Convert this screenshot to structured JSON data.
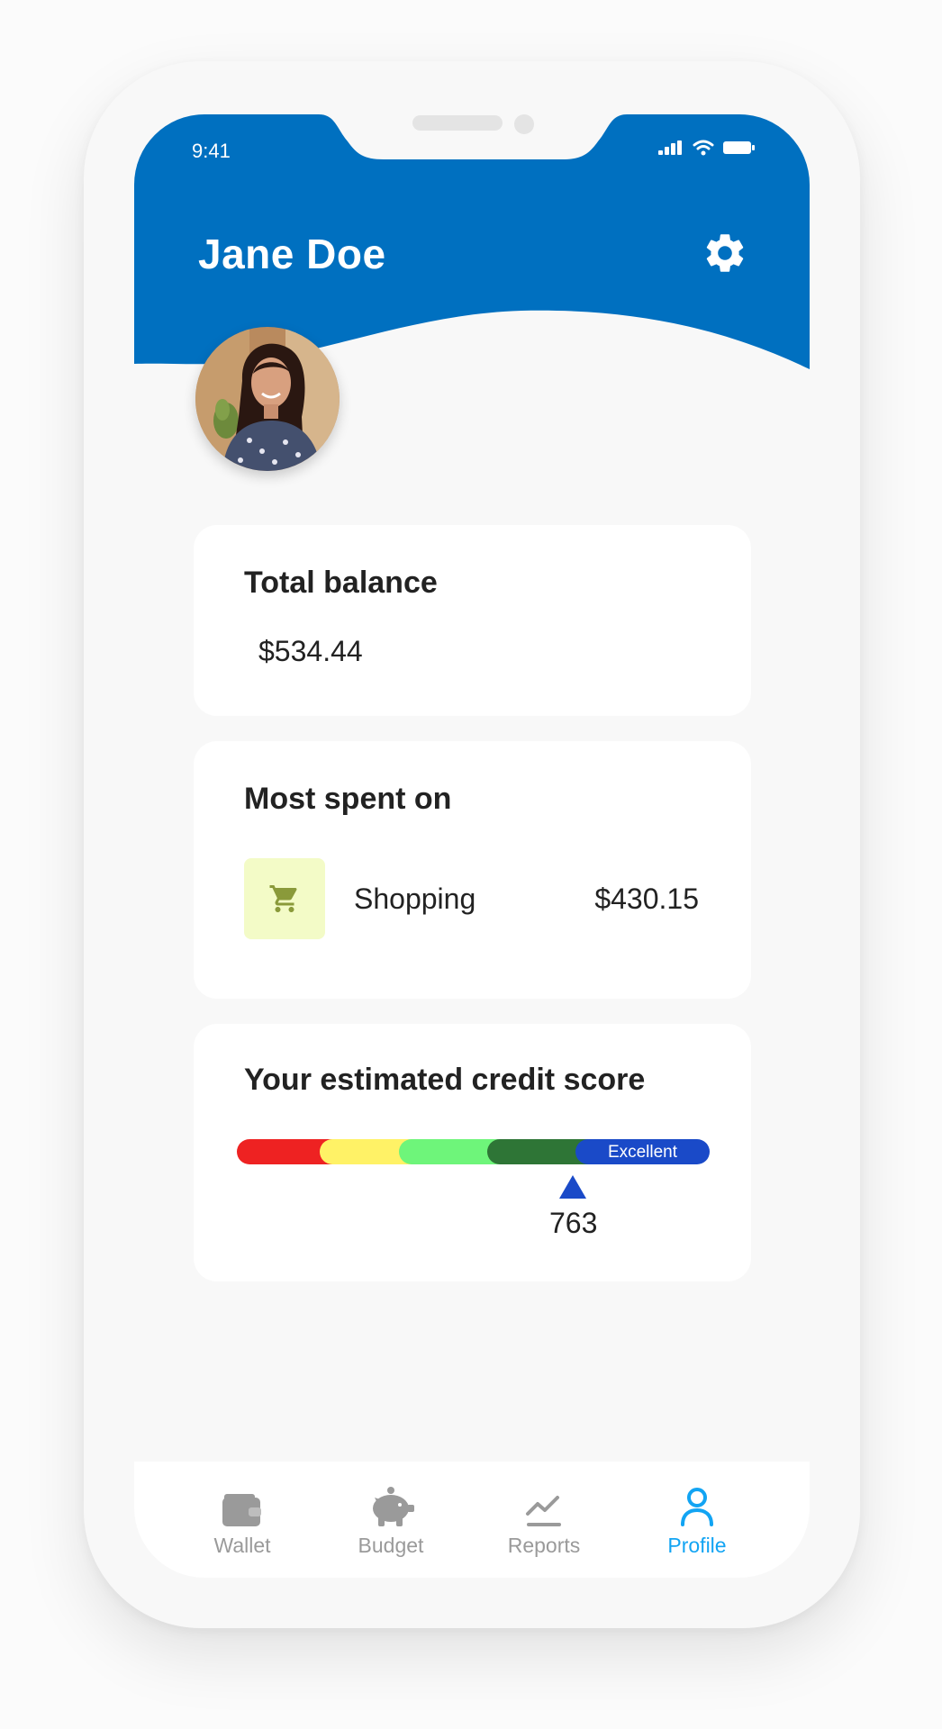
{
  "status_bar": {
    "time": "9:41"
  },
  "header": {
    "user_name": "Jane Doe",
    "settings_icon": "gear-icon",
    "brand_color": "#0070c0"
  },
  "balance_card": {
    "title": "Total balance",
    "value": "$534.44"
  },
  "spent_card": {
    "title": "Most spent on",
    "category": "Shopping",
    "amount": "$430.15",
    "icon": "cart-icon",
    "icon_color": "#8a9a3a",
    "icon_bg": "#f3fbc7"
  },
  "credit_card": {
    "title": "Your estimated credit score",
    "rating": "Excellent",
    "score": "763",
    "score_level_fraction": 0.81,
    "segment_colors": [
      "#ee2222",
      "#fff266",
      "#6ef57a",
      "#2e7536",
      "#1a4ac8"
    ]
  },
  "tabbar": {
    "active_color": "#12a4f3",
    "inactive_color": "#9a9a9a",
    "tabs": [
      {
        "label": "Wallet",
        "icon": "wallet-icon",
        "active": false
      },
      {
        "label": "Budget",
        "icon": "piggy-bank-icon",
        "active": false
      },
      {
        "label": "Reports",
        "icon": "chart-line-icon",
        "active": false
      },
      {
        "label": "Profile",
        "icon": "user-icon",
        "active": true
      }
    ]
  }
}
